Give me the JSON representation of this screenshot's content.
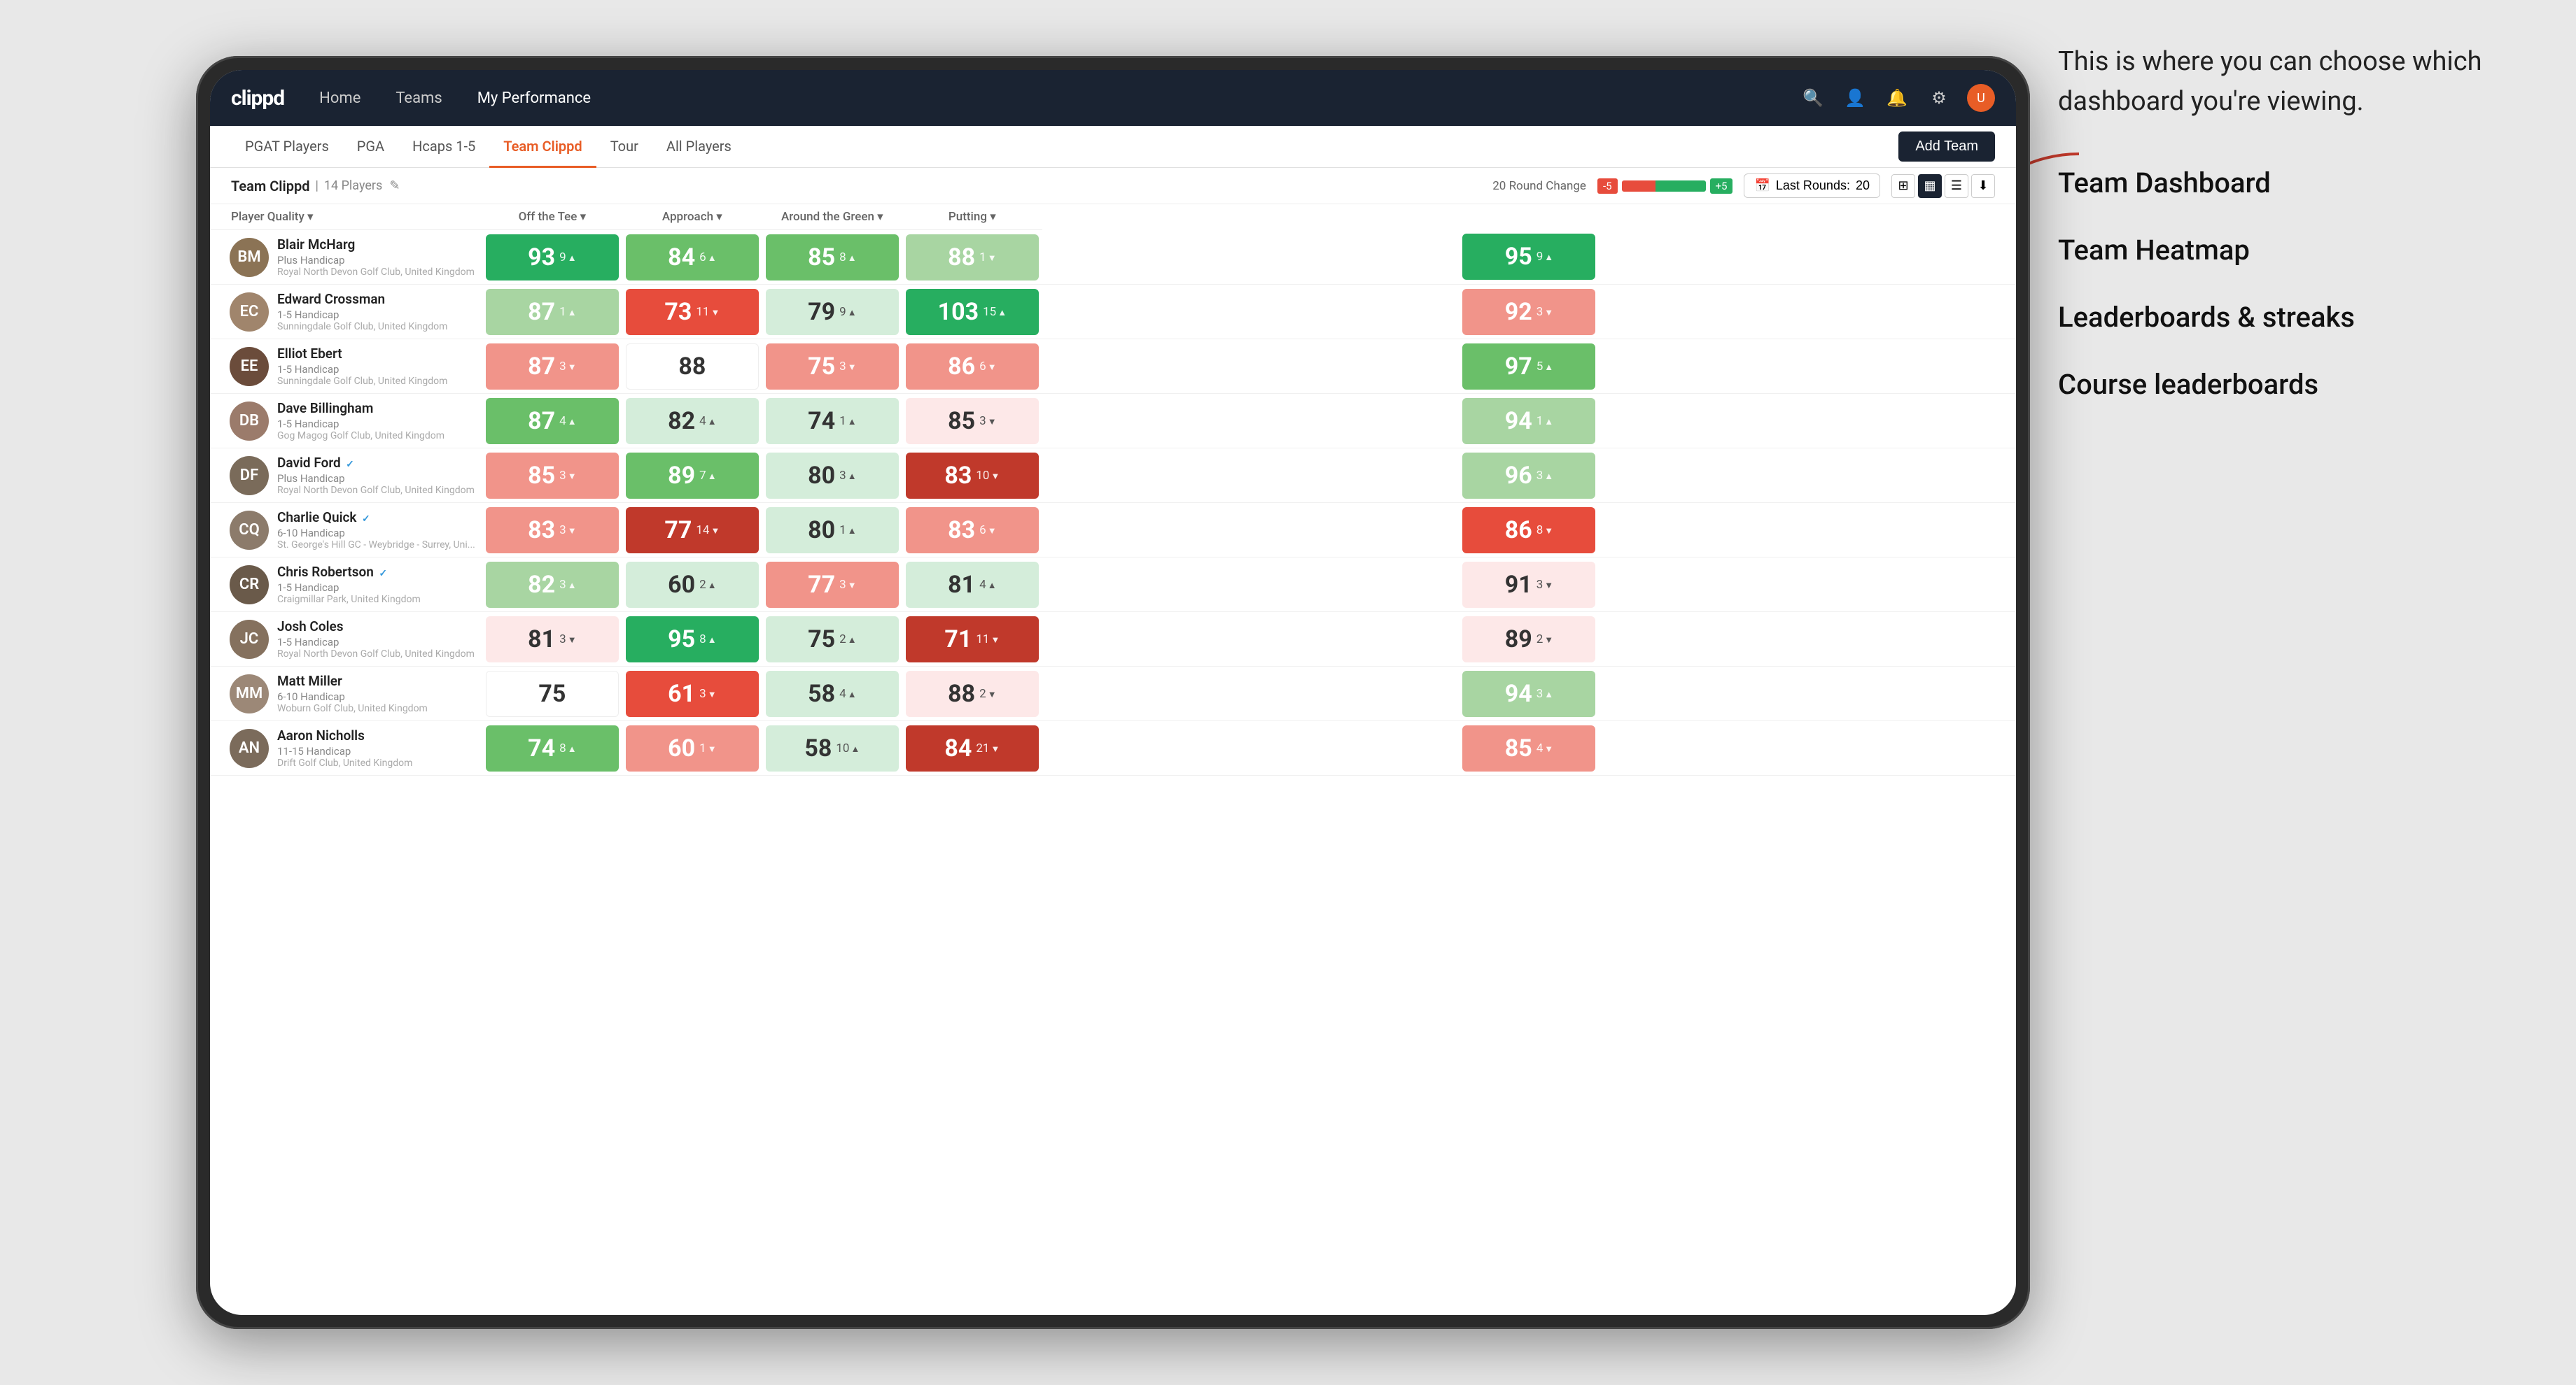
{
  "annotation": {
    "intro": "This is where you can choose which dashboard you're viewing.",
    "items": [
      "Team Dashboard",
      "Team Heatmap",
      "Leaderboards & streaks",
      "Course leaderboards"
    ]
  },
  "nav": {
    "logo": "clippd",
    "links": [
      "Home",
      "Teams",
      "My Performance"
    ],
    "active_link": "My Performance"
  },
  "sub_nav": {
    "links": [
      "PGAT Players",
      "PGA",
      "Hcaps 1-5",
      "Team Clippd",
      "Tour",
      "All Players"
    ],
    "active": "Team Clippd",
    "add_team_label": "Add Team"
  },
  "team_header": {
    "name": "Team Clippd",
    "separator": "|",
    "count": "14 Players",
    "round_change_label": "20 Round Change",
    "change_neg": "-5",
    "change_pos": "+5",
    "last_rounds_label": "Last Rounds:",
    "last_rounds_value": "20"
  },
  "table": {
    "col_headers": [
      "Player Quality ▾",
      "Off the Tee ▾",
      "Approach ▾",
      "Around the Green ▾",
      "Putting ▾"
    ],
    "players": [
      {
        "name": "Blair McHarg",
        "handicap": "Plus Handicap",
        "club": "Royal North Devon Golf Club, United Kingdom",
        "avatar_color": "#8B7355",
        "avatar_initials": "BM",
        "scores": [
          {
            "value": "93",
            "change": "9",
            "dir": "up",
            "color": "green-dark"
          },
          {
            "value": "84",
            "change": "6",
            "dir": "up",
            "color": "green-mid"
          },
          {
            "value": "85",
            "change": "8",
            "dir": "up",
            "color": "green-mid"
          },
          {
            "value": "88",
            "change": "-1",
            "dir": "down",
            "color": "green-light"
          },
          {
            "value": "95",
            "change": "9",
            "dir": "up",
            "color": "green-dark"
          }
        ]
      },
      {
        "name": "Edward Crossman",
        "handicap": "1-5 Handicap",
        "club": "Sunningdale Golf Club, United Kingdom",
        "avatar_color": "#A0856C",
        "avatar_initials": "EC",
        "scores": [
          {
            "value": "87",
            "change": "1",
            "dir": "up",
            "color": "green-light"
          },
          {
            "value": "73",
            "change": "-11",
            "dir": "down",
            "color": "red-mid"
          },
          {
            "value": "79",
            "change": "9",
            "dir": "up",
            "color": "light-green"
          },
          {
            "value": "103",
            "change": "15",
            "dir": "up",
            "color": "green-dark"
          },
          {
            "value": "92",
            "change": "-3",
            "dir": "down",
            "color": "red-light"
          }
        ]
      },
      {
        "name": "Elliot Ebert",
        "handicap": "1-5 Handicap",
        "club": "Sunningdale Golf Club, United Kingdom",
        "avatar_color": "#6B4C3B",
        "avatar_initials": "EE",
        "scores": [
          {
            "value": "87",
            "change": "-3",
            "dir": "down",
            "color": "red-light"
          },
          {
            "value": "88",
            "change": "",
            "dir": "",
            "color": "white"
          },
          {
            "value": "75",
            "change": "-3",
            "dir": "down",
            "color": "red-light"
          },
          {
            "value": "86",
            "change": "-6",
            "dir": "down",
            "color": "red-light"
          },
          {
            "value": "97",
            "change": "5",
            "dir": "up",
            "color": "green-mid"
          }
        ]
      },
      {
        "name": "Dave Billingham",
        "handicap": "1-5 Handicap",
        "club": "Gog Magog Golf Club, United Kingdom",
        "avatar_color": "#9B7B6B",
        "avatar_initials": "DB",
        "scores": [
          {
            "value": "87",
            "change": "4",
            "dir": "up",
            "color": "green-mid"
          },
          {
            "value": "82",
            "change": "4",
            "dir": "up",
            "color": "light-green"
          },
          {
            "value": "74",
            "change": "1",
            "dir": "up",
            "color": "light-green"
          },
          {
            "value": "85",
            "change": "-3",
            "dir": "down",
            "color": "light-red"
          },
          {
            "value": "94",
            "change": "1",
            "dir": "up",
            "color": "green-light"
          }
        ]
      },
      {
        "name": "David Ford",
        "handicap": "Plus Handicap",
        "club": "Royal North Devon Golf Club, United Kingdom",
        "avatar_color": "#7A6B5A",
        "avatar_initials": "DF",
        "verified": true,
        "scores": [
          {
            "value": "85",
            "change": "-3",
            "dir": "down",
            "color": "red-light"
          },
          {
            "value": "89",
            "change": "7",
            "dir": "up",
            "color": "green-mid"
          },
          {
            "value": "80",
            "change": "3",
            "dir": "up",
            "color": "light-green"
          },
          {
            "value": "83",
            "change": "-10",
            "dir": "down",
            "color": "red-dark"
          },
          {
            "value": "96",
            "change": "3",
            "dir": "up",
            "color": "green-light"
          }
        ]
      },
      {
        "name": "Charlie Quick",
        "handicap": "6-10 Handicap",
        "club": "St. George's Hill GC - Weybridge - Surrey, Uni...",
        "avatar_color": "#8C7B6B",
        "avatar_initials": "CQ",
        "verified": true,
        "scores": [
          {
            "value": "83",
            "change": "-3",
            "dir": "down",
            "color": "red-light"
          },
          {
            "value": "77",
            "change": "-14",
            "dir": "down",
            "color": "red-dark"
          },
          {
            "value": "80",
            "change": "1",
            "dir": "up",
            "color": "light-green"
          },
          {
            "value": "83",
            "change": "-6",
            "dir": "down",
            "color": "red-light"
          },
          {
            "value": "86",
            "change": "-8",
            "dir": "down",
            "color": "red-mid"
          }
        ]
      },
      {
        "name": "Chris Robertson",
        "handicap": "1-5 Handicap",
        "club": "Craigmillar Park, United Kingdom",
        "avatar_color": "#6A5A4A",
        "avatar_initials": "CR",
        "verified": true,
        "scores": [
          {
            "value": "82",
            "change": "3",
            "dir": "up",
            "color": "green-light"
          },
          {
            "value": "60",
            "change": "2",
            "dir": "up",
            "color": "light-green"
          },
          {
            "value": "77",
            "change": "-3",
            "dir": "down",
            "color": "red-light"
          },
          {
            "value": "81",
            "change": "4",
            "dir": "up",
            "color": "light-green"
          },
          {
            "value": "91",
            "change": "-3",
            "dir": "down",
            "color": "light-red"
          }
        ]
      },
      {
        "name": "Josh Coles",
        "handicap": "1-5 Handicap",
        "club": "Royal North Devon Golf Club, United Kingdom",
        "avatar_color": "#85715E",
        "avatar_initials": "JC",
        "scores": [
          {
            "value": "81",
            "change": "-3",
            "dir": "down",
            "color": "light-red"
          },
          {
            "value": "95",
            "change": "8",
            "dir": "up",
            "color": "green-dark"
          },
          {
            "value": "75",
            "change": "2",
            "dir": "up",
            "color": "light-green"
          },
          {
            "value": "71",
            "change": "-11",
            "dir": "down",
            "color": "red-dark"
          },
          {
            "value": "89",
            "change": "-2",
            "dir": "down",
            "color": "light-red"
          }
        ]
      },
      {
        "name": "Matt Miller",
        "handicap": "6-10 Handicap",
        "club": "Woburn Golf Club, United Kingdom",
        "avatar_color": "#9C8877",
        "avatar_initials": "MM",
        "scores": [
          {
            "value": "75",
            "change": "",
            "dir": "",
            "color": "white"
          },
          {
            "value": "61",
            "change": "-3",
            "dir": "down",
            "color": "red-mid"
          },
          {
            "value": "58",
            "change": "4",
            "dir": "up",
            "color": "light-green"
          },
          {
            "value": "88",
            "change": "-2",
            "dir": "down",
            "color": "light-red"
          },
          {
            "value": "94",
            "change": "3",
            "dir": "up",
            "color": "green-light"
          }
        ]
      },
      {
        "name": "Aaron Nicholls",
        "handicap": "11-15 Handicap",
        "club": "Drift Golf Club, United Kingdom",
        "avatar_color": "#7B6B5B",
        "avatar_initials": "AN",
        "scores": [
          {
            "value": "74",
            "change": "8",
            "dir": "up",
            "color": "green-mid"
          },
          {
            "value": "60",
            "change": "-1",
            "dir": "down",
            "color": "red-light"
          },
          {
            "value": "58",
            "change": "10",
            "dir": "up",
            "color": "light-green"
          },
          {
            "value": "84",
            "change": "-21",
            "dir": "down",
            "color": "red-dark"
          },
          {
            "value": "85",
            "change": "-4",
            "dir": "down",
            "color": "red-light"
          }
        ]
      }
    ]
  }
}
